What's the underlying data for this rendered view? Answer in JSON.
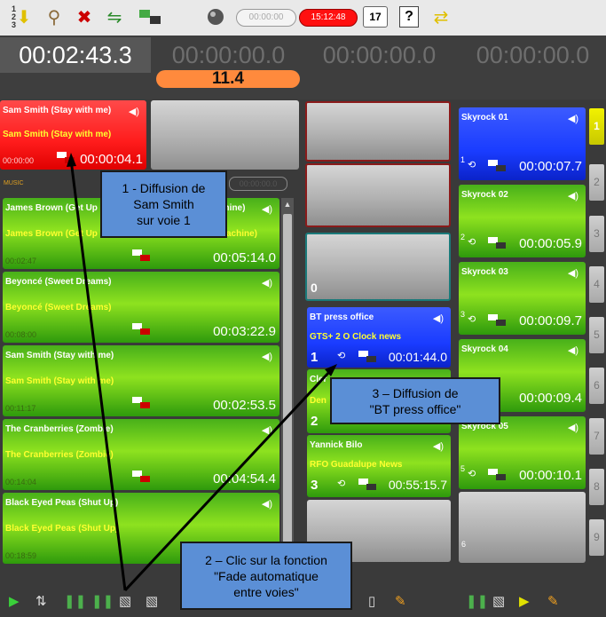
{
  "toolbar": {
    "icon_numbers": "1 2 3",
    "time_empty": "00:00:00",
    "time_clock": "15:12:48",
    "calendar_day": "17",
    "help_label": "?"
  },
  "timers": {
    "main": "00:02:43.3",
    "col2": "00:00:00.0",
    "col2_sub": "11.4",
    "col3": "00:00:00.0",
    "col4": "00:00:00.0"
  },
  "col1": {
    "playing": {
      "title": "Sam Smith (Stay with me)",
      "subtitle": "Sam Smith (Stay with me)",
      "start": "00:00:00",
      "duration": "00:00:04.1"
    },
    "section_label": "MUSIC",
    "section_time": "00:00:00.0",
    "items": [
      {
        "title": "James Brown (Get Up",
        "title_tail": "chine)",
        "subtitle": "James Brown (Get Up",
        "subtitle_tail": "achine)",
        "start": "00:02:47",
        "duration": "00:05:14.0"
      },
      {
        "title": "Beyoncé (Sweet Dreams)",
        "subtitle": "Beyoncé (Sweet Dreams)",
        "start": "00:08:00",
        "duration": "00:03:22.9"
      },
      {
        "title": "Sam Smith (Stay with me)",
        "subtitle": "Sam Smith (Stay with me)",
        "start": "00:11:17",
        "duration": "00:02:53.5"
      },
      {
        "title": "The Cranberries (Zombie)",
        "subtitle": "The Cranberries (Zombie)",
        "start": "00:14:04",
        "duration": "00:04:54.4"
      },
      {
        "title": "Black Eyed Peas (Shut Up)",
        "subtitle": "Black Eyed Peas (Shut Up)",
        "start": "00:18:59",
        "duration": ""
      }
    ]
  },
  "col3": {
    "gray_count": "0",
    "items": [
      {
        "title": "BT press office",
        "subtitle": "GTS+ 2 O Clock news",
        "num": "1",
        "duration": "00:01:44.0"
      },
      {
        "title": "Cler",
        "subtitle": "Den",
        "num": "2",
        "duration": ""
      },
      {
        "title": "Yannick Bilo",
        "subtitle": "RFO Guadalupe News",
        "num": "3",
        "duration": "00:55:15.7"
      }
    ]
  },
  "col4": {
    "items": [
      {
        "title": "Skyrock 01",
        "num": "1",
        "duration": "00:00:07.7"
      },
      {
        "title": "Skyrock 02",
        "num": "2",
        "duration": "00:00:05.9"
      },
      {
        "title": "Skyrock 03",
        "num": "3",
        "duration": "00:00:09.7"
      },
      {
        "title": "Skyrock 04",
        "num": "",
        "duration": "00:00:09.4"
      },
      {
        "title": "Skyrock 05",
        "num": "5",
        "duration": "00:00:10.1"
      }
    ],
    "last_num": "6",
    "numbers": [
      "1",
      "2",
      "3",
      "4",
      "5",
      "6",
      "7",
      "8",
      "9"
    ]
  },
  "callouts": {
    "c1": [
      "1 - Diffusion de",
      "Sam Smith",
      "sur voie 1"
    ],
    "c2": [
      "2 – Clic sur la fonction",
      "\"Fade automatique",
      "entre voies\""
    ],
    "c3": [
      "3 – Diffusion de",
      "\"BT press office\""
    ]
  },
  "colors": {
    "playing": "#ff1c1c",
    "queued": "#6fd21d",
    "news": "#1a3cff",
    "accent_orange": "#ff8a3d",
    "active_number": "#e8e800"
  }
}
